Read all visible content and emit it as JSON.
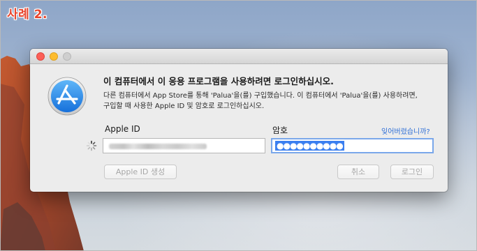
{
  "caption": "사례 2.",
  "window": {
    "traffic_lights": [
      "close",
      "minimize",
      "zoom"
    ]
  },
  "dialog": {
    "icon": "app-store-icon",
    "heading": "이 컴퓨터에서 이 응용 프로그램을 사용하려면 로그인하십시오.",
    "description_line1": "다른 컴퓨터에서 App Store를 통해 'Palua'을(를) 구입했습니다. 이 컴퓨터에서 'Palua'을(를) 사용하려면,",
    "description_line2": "구입할 때 사용한 Apple ID 및 암호로 로그인하십시오.",
    "apple_id_label": "Apple ID",
    "password_label": "암호",
    "forgot_link": "잊어버렸습니까?",
    "password_value": "●●●●●●●●●●",
    "buttons": {
      "create_apple_id": "Apple ID 생성",
      "cancel": "취소",
      "login": "로그인"
    }
  },
  "colors": {
    "accent": "#2f6fd6",
    "selection": "#3b7ff0",
    "caption": "#e8442c"
  }
}
